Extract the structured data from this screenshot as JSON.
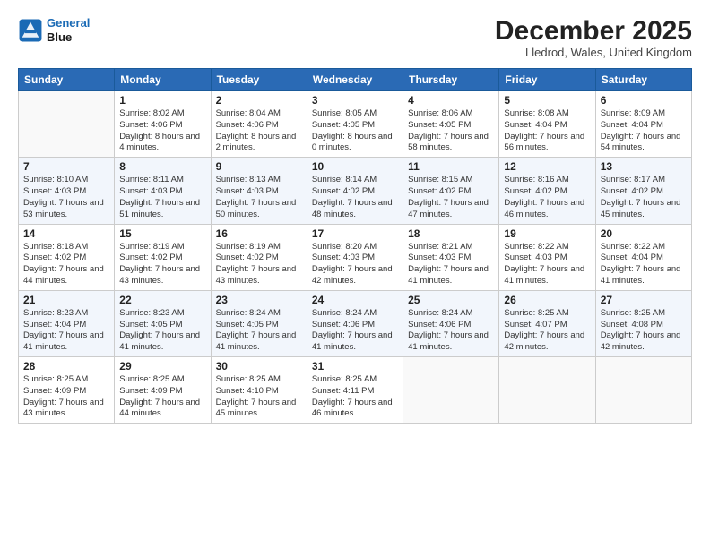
{
  "header": {
    "logo_line1": "General",
    "logo_line2": "Blue",
    "month": "December 2025",
    "location": "Lledrod, Wales, United Kingdom"
  },
  "weekdays": [
    "Sunday",
    "Monday",
    "Tuesday",
    "Wednesday",
    "Thursday",
    "Friday",
    "Saturday"
  ],
  "weeks": [
    [
      {
        "day": "",
        "sunrise": "",
        "sunset": "",
        "daylight": ""
      },
      {
        "day": "1",
        "sunrise": "Sunrise: 8:02 AM",
        "sunset": "Sunset: 4:06 PM",
        "daylight": "Daylight: 8 hours and 4 minutes."
      },
      {
        "day": "2",
        "sunrise": "Sunrise: 8:04 AM",
        "sunset": "Sunset: 4:06 PM",
        "daylight": "Daylight: 8 hours and 2 minutes."
      },
      {
        "day": "3",
        "sunrise": "Sunrise: 8:05 AM",
        "sunset": "Sunset: 4:05 PM",
        "daylight": "Daylight: 8 hours and 0 minutes."
      },
      {
        "day": "4",
        "sunrise": "Sunrise: 8:06 AM",
        "sunset": "Sunset: 4:05 PM",
        "daylight": "Daylight: 7 hours and 58 minutes."
      },
      {
        "day": "5",
        "sunrise": "Sunrise: 8:08 AM",
        "sunset": "Sunset: 4:04 PM",
        "daylight": "Daylight: 7 hours and 56 minutes."
      },
      {
        "day": "6",
        "sunrise": "Sunrise: 8:09 AM",
        "sunset": "Sunset: 4:04 PM",
        "daylight": "Daylight: 7 hours and 54 minutes."
      }
    ],
    [
      {
        "day": "7",
        "sunrise": "Sunrise: 8:10 AM",
        "sunset": "Sunset: 4:03 PM",
        "daylight": "Daylight: 7 hours and 53 minutes."
      },
      {
        "day": "8",
        "sunrise": "Sunrise: 8:11 AM",
        "sunset": "Sunset: 4:03 PM",
        "daylight": "Daylight: 7 hours and 51 minutes."
      },
      {
        "day": "9",
        "sunrise": "Sunrise: 8:13 AM",
        "sunset": "Sunset: 4:03 PM",
        "daylight": "Daylight: 7 hours and 50 minutes."
      },
      {
        "day": "10",
        "sunrise": "Sunrise: 8:14 AM",
        "sunset": "Sunset: 4:02 PM",
        "daylight": "Daylight: 7 hours and 48 minutes."
      },
      {
        "day": "11",
        "sunrise": "Sunrise: 8:15 AM",
        "sunset": "Sunset: 4:02 PM",
        "daylight": "Daylight: 7 hours and 47 minutes."
      },
      {
        "day": "12",
        "sunrise": "Sunrise: 8:16 AM",
        "sunset": "Sunset: 4:02 PM",
        "daylight": "Daylight: 7 hours and 46 minutes."
      },
      {
        "day": "13",
        "sunrise": "Sunrise: 8:17 AM",
        "sunset": "Sunset: 4:02 PM",
        "daylight": "Daylight: 7 hours and 45 minutes."
      }
    ],
    [
      {
        "day": "14",
        "sunrise": "Sunrise: 8:18 AM",
        "sunset": "Sunset: 4:02 PM",
        "daylight": "Daylight: 7 hours and 44 minutes."
      },
      {
        "day": "15",
        "sunrise": "Sunrise: 8:19 AM",
        "sunset": "Sunset: 4:02 PM",
        "daylight": "Daylight: 7 hours and 43 minutes."
      },
      {
        "day": "16",
        "sunrise": "Sunrise: 8:19 AM",
        "sunset": "Sunset: 4:02 PM",
        "daylight": "Daylight: 7 hours and 43 minutes."
      },
      {
        "day": "17",
        "sunrise": "Sunrise: 8:20 AM",
        "sunset": "Sunset: 4:03 PM",
        "daylight": "Daylight: 7 hours and 42 minutes."
      },
      {
        "day": "18",
        "sunrise": "Sunrise: 8:21 AM",
        "sunset": "Sunset: 4:03 PM",
        "daylight": "Daylight: 7 hours and 41 minutes."
      },
      {
        "day": "19",
        "sunrise": "Sunrise: 8:22 AM",
        "sunset": "Sunset: 4:03 PM",
        "daylight": "Daylight: 7 hours and 41 minutes."
      },
      {
        "day": "20",
        "sunrise": "Sunrise: 8:22 AM",
        "sunset": "Sunset: 4:04 PM",
        "daylight": "Daylight: 7 hours and 41 minutes."
      }
    ],
    [
      {
        "day": "21",
        "sunrise": "Sunrise: 8:23 AM",
        "sunset": "Sunset: 4:04 PM",
        "daylight": "Daylight: 7 hours and 41 minutes."
      },
      {
        "day": "22",
        "sunrise": "Sunrise: 8:23 AM",
        "sunset": "Sunset: 4:05 PM",
        "daylight": "Daylight: 7 hours and 41 minutes."
      },
      {
        "day": "23",
        "sunrise": "Sunrise: 8:24 AM",
        "sunset": "Sunset: 4:05 PM",
        "daylight": "Daylight: 7 hours and 41 minutes."
      },
      {
        "day": "24",
        "sunrise": "Sunrise: 8:24 AM",
        "sunset": "Sunset: 4:06 PM",
        "daylight": "Daylight: 7 hours and 41 minutes."
      },
      {
        "day": "25",
        "sunrise": "Sunrise: 8:24 AM",
        "sunset": "Sunset: 4:06 PM",
        "daylight": "Daylight: 7 hours and 41 minutes."
      },
      {
        "day": "26",
        "sunrise": "Sunrise: 8:25 AM",
        "sunset": "Sunset: 4:07 PM",
        "daylight": "Daylight: 7 hours and 42 minutes."
      },
      {
        "day": "27",
        "sunrise": "Sunrise: 8:25 AM",
        "sunset": "Sunset: 4:08 PM",
        "daylight": "Daylight: 7 hours and 42 minutes."
      }
    ],
    [
      {
        "day": "28",
        "sunrise": "Sunrise: 8:25 AM",
        "sunset": "Sunset: 4:09 PM",
        "daylight": "Daylight: 7 hours and 43 minutes."
      },
      {
        "day": "29",
        "sunrise": "Sunrise: 8:25 AM",
        "sunset": "Sunset: 4:09 PM",
        "daylight": "Daylight: 7 hours and 44 minutes."
      },
      {
        "day": "30",
        "sunrise": "Sunrise: 8:25 AM",
        "sunset": "Sunset: 4:10 PM",
        "daylight": "Daylight: 7 hours and 45 minutes."
      },
      {
        "day": "31",
        "sunrise": "Sunrise: 8:25 AM",
        "sunset": "Sunset: 4:11 PM",
        "daylight": "Daylight: 7 hours and 46 minutes."
      },
      {
        "day": "",
        "sunrise": "",
        "sunset": "",
        "daylight": ""
      },
      {
        "day": "",
        "sunrise": "",
        "sunset": "",
        "daylight": ""
      },
      {
        "day": "",
        "sunrise": "",
        "sunset": "",
        "daylight": ""
      }
    ]
  ]
}
